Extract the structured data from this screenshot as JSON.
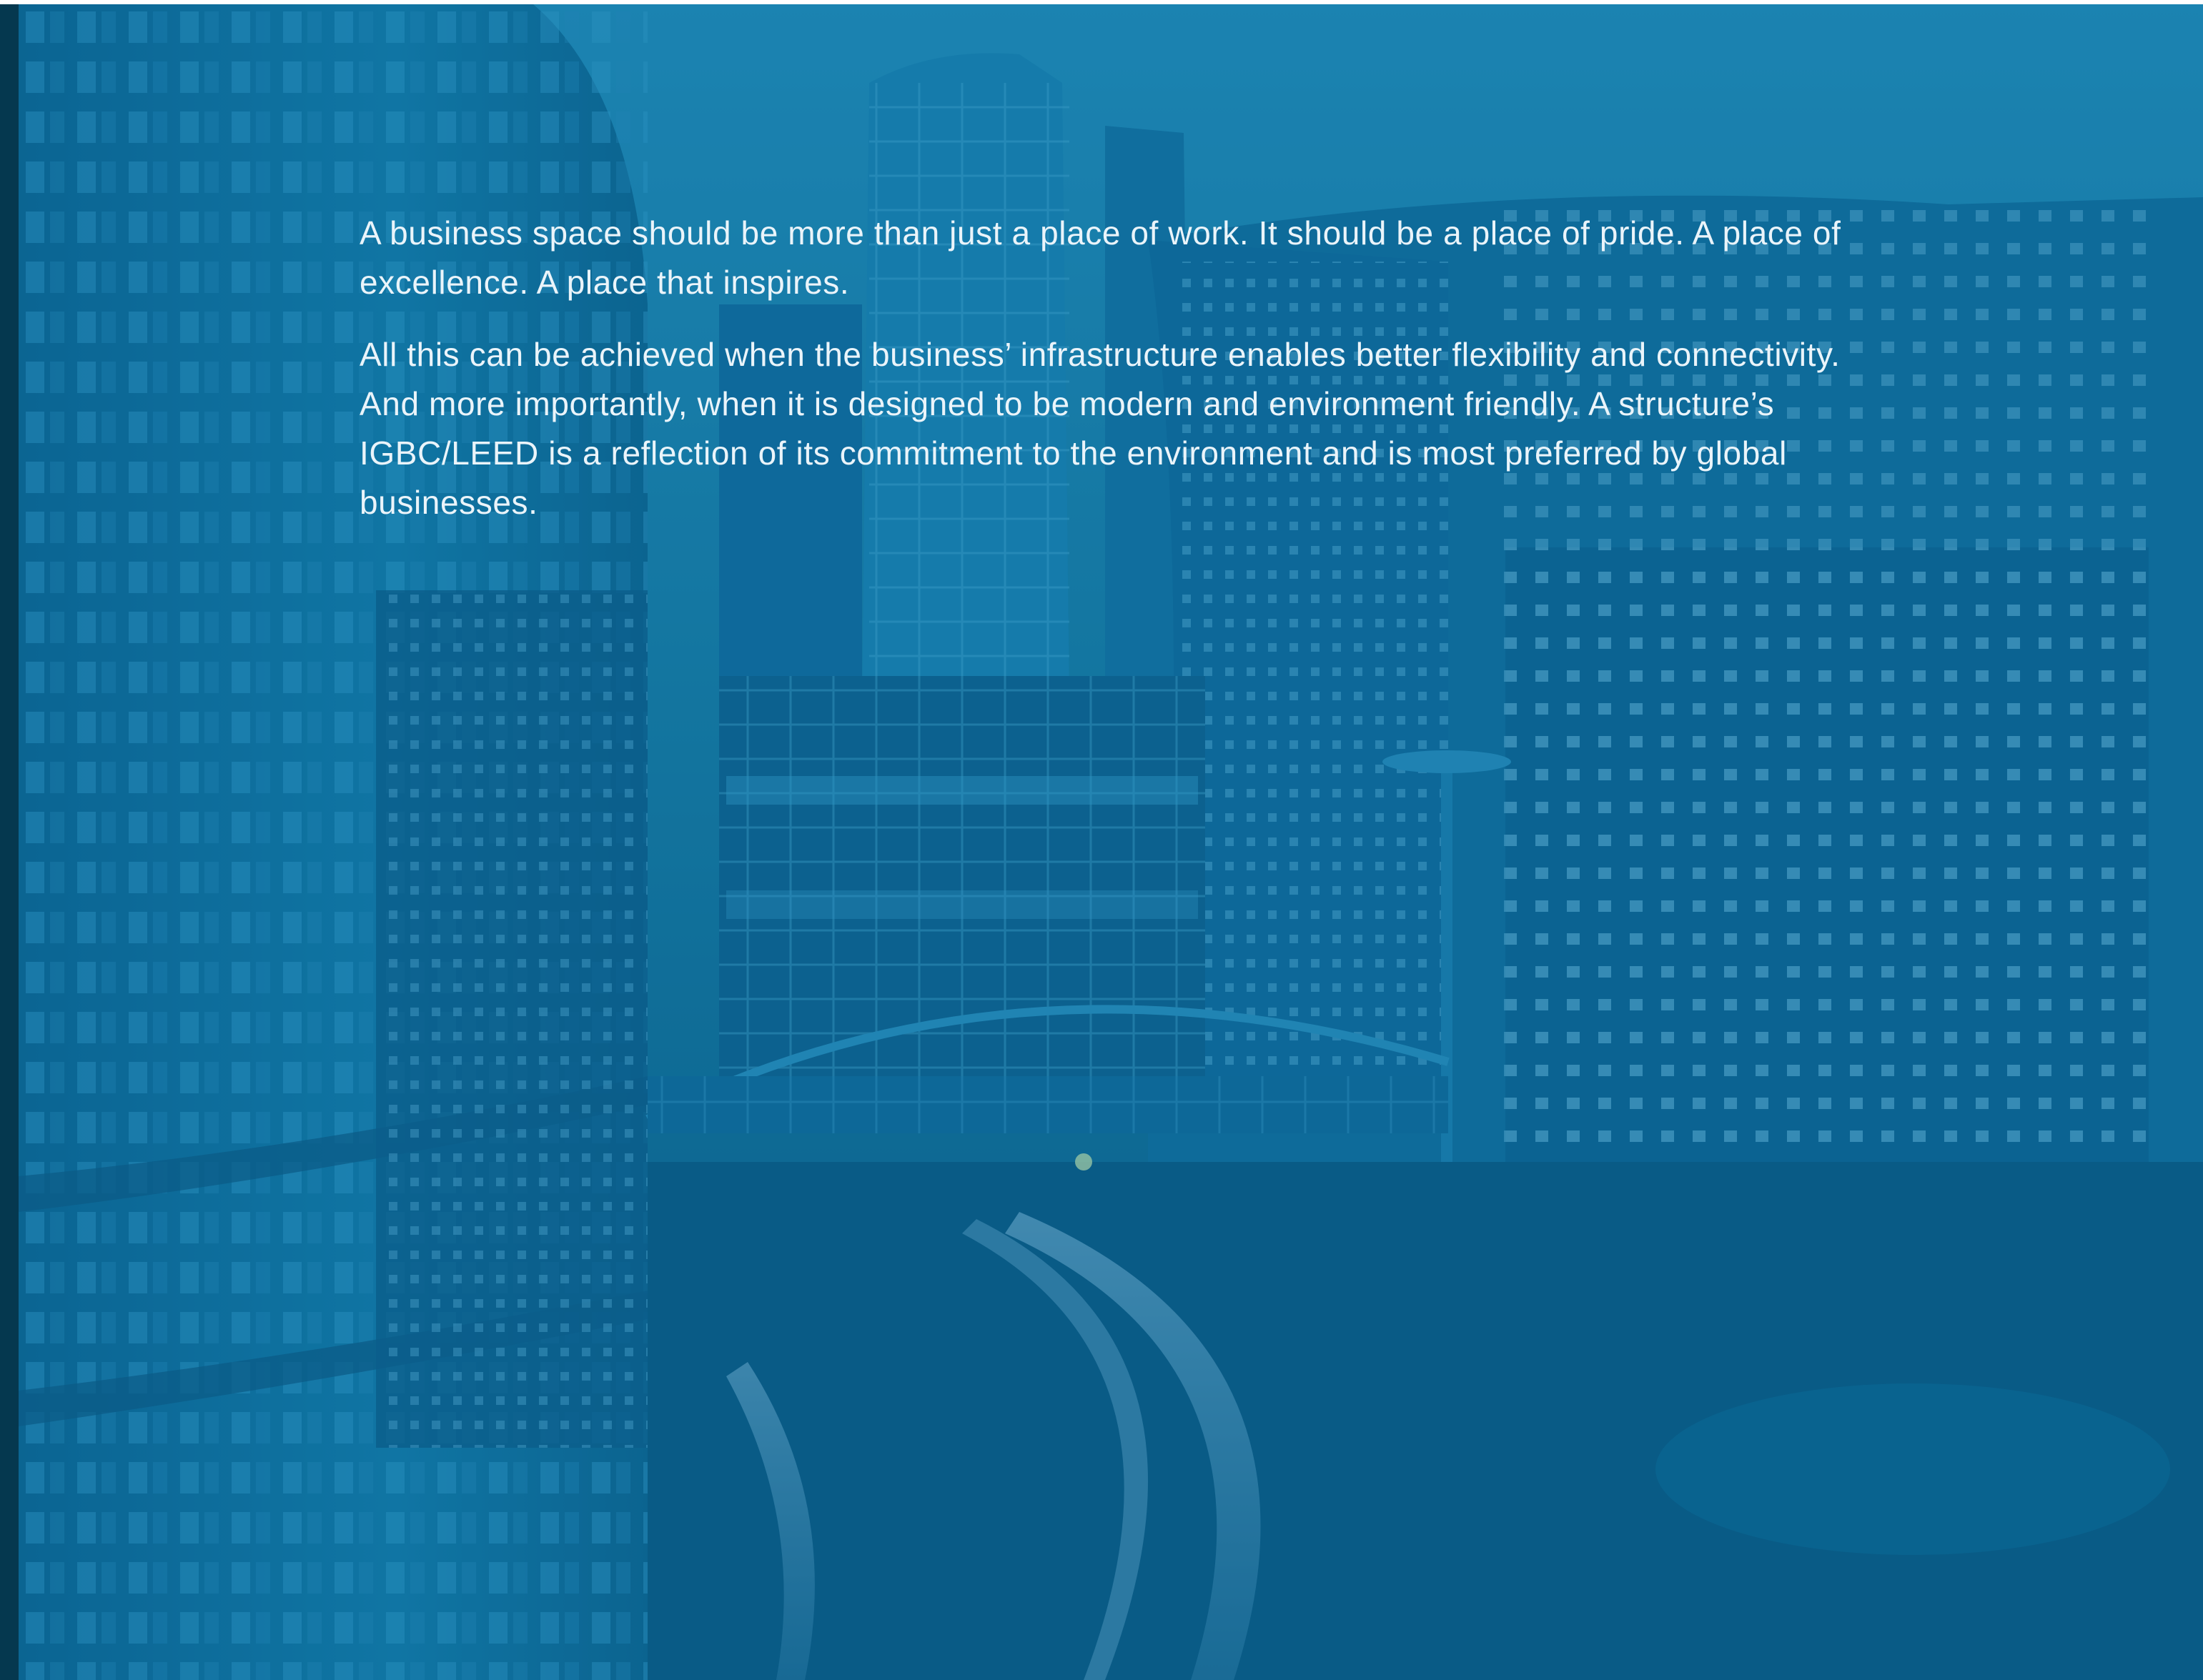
{
  "document": {
    "paragraphs": [
      "A business space should be more than just a place of work. It should be a place of pride. A place of excellence. A place that inspires.",
      "All this can be achieved when the business’ infrastructure enables better flexibility and connectivity. And more importantly, when it is designed to be modern and environment friendly. A structure’s IGBC/LEED is a reflection of its commitment to the environment and is most preferred by global businesses."
    ]
  },
  "colors": {
    "tint": "#0d6f9e",
    "sky": "#1f8ab8",
    "deep": "#07557f",
    "strip": "#05384f",
    "text": "#eaf4fa"
  }
}
